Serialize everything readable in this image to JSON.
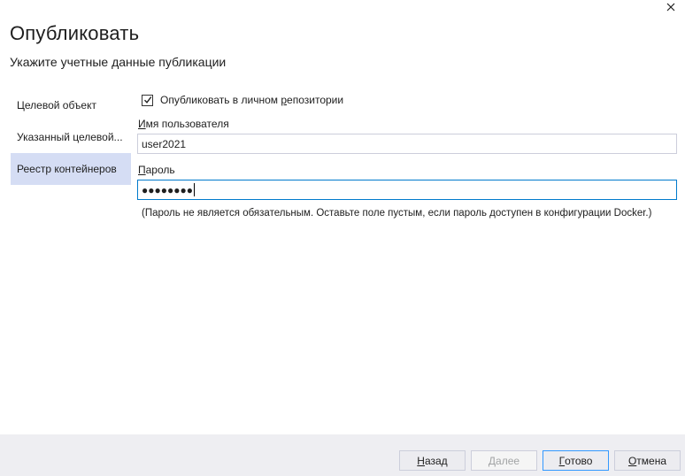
{
  "dialog": {
    "title": "Опубликовать",
    "subtitle": "Укажите учетные данные публикации"
  },
  "nav": {
    "items": [
      {
        "label": "Целевой объект",
        "active": false
      },
      {
        "label": "Указанный целевой...",
        "active": false
      },
      {
        "label": "Реестр контейнеров",
        "active": true
      }
    ]
  },
  "form": {
    "private_repo_checkbox": {
      "label_pre": "Опубликовать в личном ",
      "label_mnemonic": "р",
      "label_post": "епозитории",
      "checked": true
    },
    "username": {
      "label_mnemonic": "И",
      "label_rest": "мя пользователя",
      "value": "user2021"
    },
    "password": {
      "label_mnemonic": "П",
      "label_rest": "ароль",
      "masked_value": "●●●●●●●●"
    },
    "hint": "(Пароль не является обязательным. Оставьте поле пустым, если пароль доступен в конфигурации Docker.)"
  },
  "footer": {
    "back": {
      "mnemonic": "Н",
      "rest": "азад"
    },
    "next": {
      "mnemonic": "Д",
      "rest": "алее"
    },
    "finish": {
      "mnemonic": "Г",
      "rest": "отово"
    },
    "cancel": {
      "mnemonic": "О",
      "rest": "тмена"
    }
  },
  "colors": {
    "accent": "#007acc",
    "nav_active_bg": "#d5ddf4",
    "footer_bg": "#eeeef2"
  },
  "icons": {
    "close": "close-icon",
    "check": "checkmark-icon"
  }
}
